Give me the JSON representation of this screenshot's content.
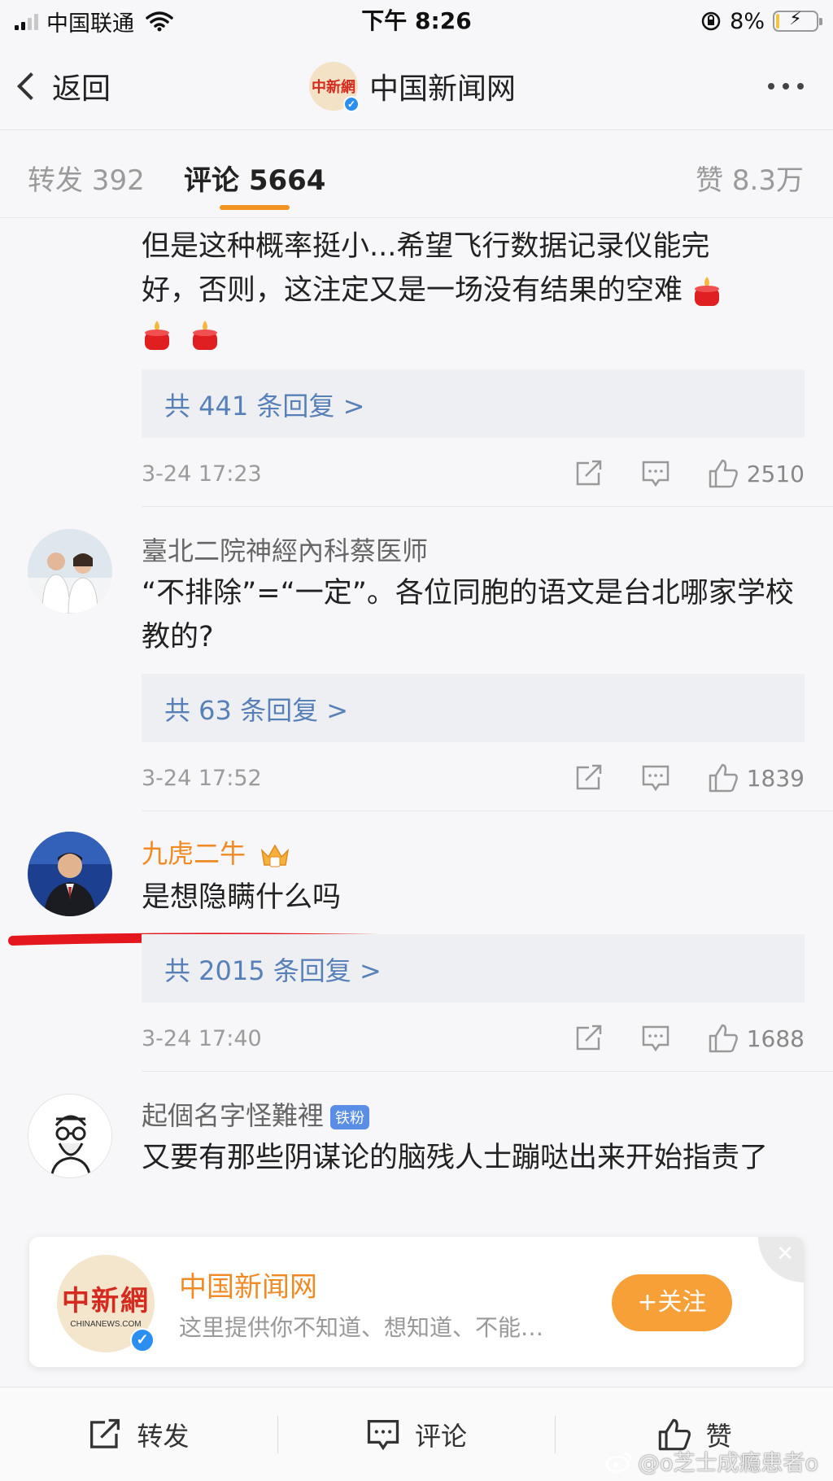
{
  "status": {
    "carrier": "中国联通",
    "time": "下午 8:26",
    "battery": "8%"
  },
  "nav": {
    "back_label": "返回",
    "account_name": "中国新闻网",
    "logo_text": "中新網"
  },
  "tabs": {
    "repost": "转发 392",
    "comment": "评论 5664",
    "like": "赞 8.3万"
  },
  "comments": [
    {
      "text_line1": "但是这种概率挺小...希望飞行数据记录仪能完",
      "text_line2": "好，否则，这注定又是一场没有结果的空难",
      "replies": "共 441 条回复 >",
      "time": "3-24 17:23",
      "likes": "2510"
    },
    {
      "user": "臺北二院神經內科蔡医师",
      "text": "“不排除”=“一定”。各位同胞的语文是台北哪家学校教的?",
      "replies": "共 63 条回复 >",
      "time": "3-24 17:52",
      "likes": "1839"
    },
    {
      "user": "九虎二牛",
      "text": "是想隐瞒什么吗",
      "replies": "共 2015 条回复 >",
      "time": "3-24 17:40",
      "likes": "1688"
    },
    {
      "user": "起個名字怪難裡",
      "badge": "铁粉",
      "text": "又要有那些阴谋论的脑残人士蹦哒出来开始指责了"
    }
  ],
  "follow_card": {
    "name": "中国新闻网",
    "desc": "这里提供你不知道、想知道、不能…",
    "button": "+关注",
    "logo_text": "中新網",
    "logo_sub": "CHINANEWS.COM"
  },
  "bottom_bar": {
    "repost": "转发",
    "comment": "评论",
    "like": "赞"
  },
  "watermark": "@o芝士成瘾患者o",
  "colors": {
    "accent_orange": "#f39322",
    "link_blue": "#5880b8",
    "vip_orange": "#f08a25",
    "annotation_red": "#e3171c"
  }
}
